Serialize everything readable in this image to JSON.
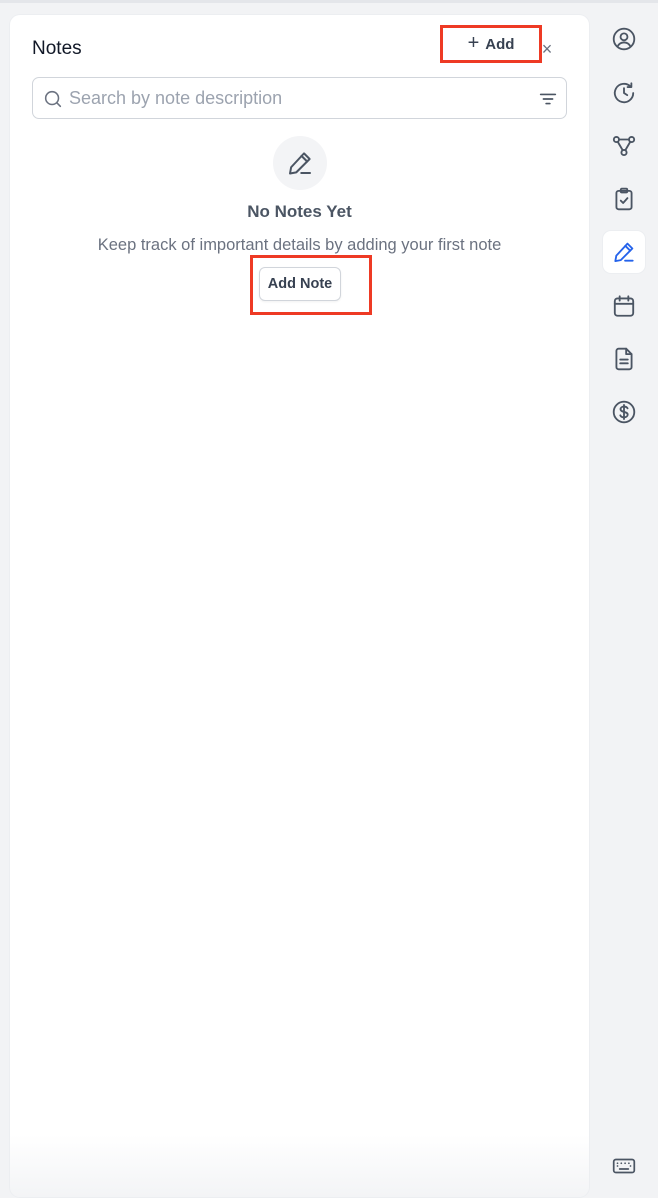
{
  "notes_panel": {
    "title": "Notes",
    "add_button_label": "Add",
    "close_symbol": "×",
    "search": {
      "placeholder": "Search by note description",
      "value": ""
    },
    "empty_state": {
      "icon": "pencil-icon",
      "title": "No Notes Yet",
      "description": "Keep track of important details by adding your first note",
      "add_note_label": "Add Note"
    }
  },
  "sidebar": {
    "items": [
      {
        "icon": "user-circle-icon",
        "active": false
      },
      {
        "icon": "history-clock-icon",
        "active": false
      },
      {
        "icon": "workflow-icon",
        "active": false
      },
      {
        "icon": "clipboard-check-icon",
        "active": false
      },
      {
        "icon": "pencil-icon",
        "active": true
      },
      {
        "icon": "calendar-icon",
        "active": false
      },
      {
        "icon": "document-icon",
        "active": false
      },
      {
        "icon": "dollar-icon",
        "active": false
      }
    ],
    "bottom_icon": "keyboard-icon"
  },
  "colors": {
    "highlight": "#ee3a24",
    "active_icon": "#2563eb",
    "icon": "#4b5563",
    "text_muted": "#6b7280"
  }
}
